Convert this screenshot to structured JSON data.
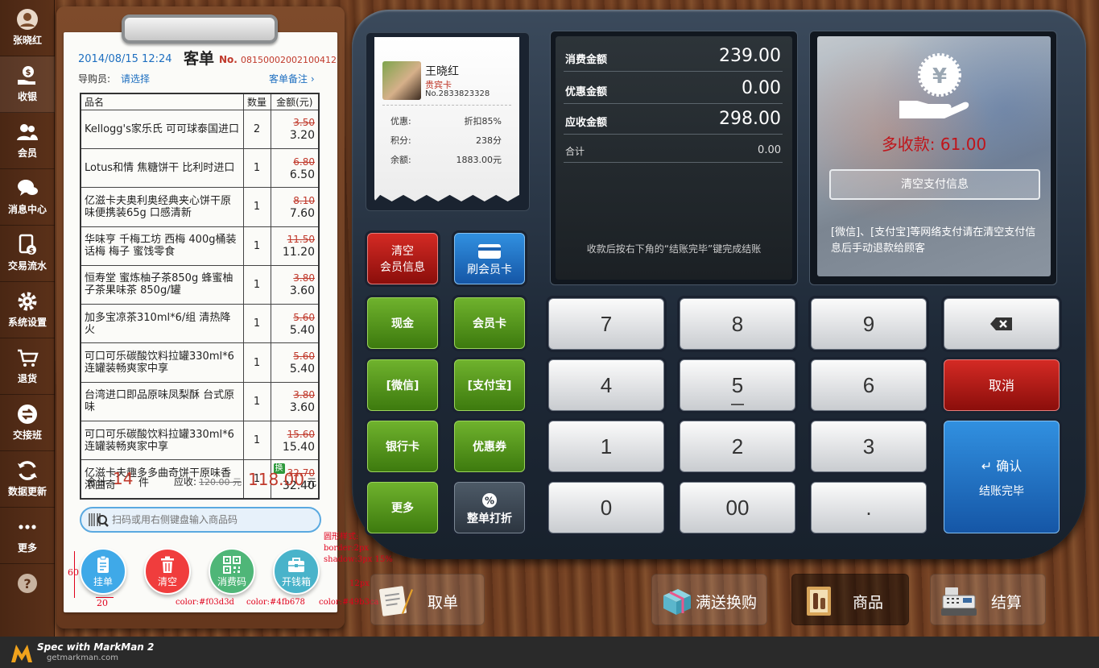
{
  "nav": {
    "items": [
      {
        "label": "张晓红",
        "icon": "user-icon"
      },
      {
        "label": "收银",
        "icon": "cash-hand-icon"
      },
      {
        "label": "会员",
        "icon": "members-icon"
      },
      {
        "label": "消息中心",
        "icon": "message-icon"
      },
      {
        "label": "交易流水",
        "icon": "transactions-icon"
      },
      {
        "label": "系统设置",
        "icon": "gear-icon"
      },
      {
        "label": "退货",
        "icon": "return-cart-icon"
      },
      {
        "label": "交接班",
        "icon": "shift-icon"
      },
      {
        "label": "数据更新",
        "icon": "refresh-icon"
      },
      {
        "label": "更多",
        "icon": "more-icon"
      },
      {
        "label": "",
        "icon": "help-icon"
      }
    ]
  },
  "order": {
    "datetime": "2014/08/15 12:24",
    "title": "客单",
    "no_label": "No.",
    "no": "08150002002100412",
    "guide_label": "导购员:",
    "guide_value": "请选择",
    "note_link": "客单备注",
    "headers": [
      "品名",
      "数量",
      "金额(元)"
    ],
    "rows": [
      {
        "name": "Kellogg's家乐氏 可可球泰国进口",
        "qty": "2",
        "old": "3.50",
        "new": "3.20",
        "badge": ""
      },
      {
        "name": "Lotus和情 焦糖饼干 比利时进口",
        "qty": "1",
        "old": "6.80",
        "new": "6.50",
        "badge": ""
      },
      {
        "name": "亿滋卡夫奥利奥经典夹心饼干原味便携装65g 口感清新",
        "qty": "1",
        "old": "8.10",
        "new": "7.60",
        "badge": ""
      },
      {
        "name": "华味亨 千梅工坊 西梅 400g桶装 话梅 梅子 蜜饯零食",
        "qty": "1",
        "old": "11.50",
        "new": "11.20",
        "badge": ""
      },
      {
        "name": "恒寿堂 蜜炼柚子茶850g 蜂蜜柚子茶果味茶 850g/罐",
        "qty": "1",
        "old": "3.80",
        "new": "3.60",
        "badge": ""
      },
      {
        "name": "加多宝凉茶310ml*6/组 清热降火",
        "qty": "1",
        "old": "5.60",
        "new": "5.40",
        "badge": ""
      },
      {
        "name": "可口可乐碳酸饮料拉罐330ml*6连罐装畅爽家中享",
        "qty": "1",
        "old": "5.60",
        "new": "5.40",
        "badge": ""
      },
      {
        "name": "台湾进口即品原味凤梨酥 台式原味",
        "qty": "1",
        "old": "3.80",
        "new": "3.60",
        "badge": ""
      },
      {
        "name": "可口可乐碳酸饮料拉罐330ml*6连罐装畅爽家中享",
        "qty": "1",
        "old": "15.60",
        "new": "15.40",
        "badge": ""
      },
      {
        "name": "亿滋卡夫趣多多曲奇饼干原味香浓曲奇",
        "qty": "1",
        "old": "32.70",
        "new": "32.40",
        "badge": "换"
      }
    ],
    "total_label": "合计",
    "total_count": "14",
    "total_unit": "件",
    "due_label": "应收:",
    "due_old": "120.00 元",
    "due_new": "118.00",
    "due_unit": "元"
  },
  "search": {
    "placeholder": "扫码或用右侧键盘输入商品码"
  },
  "actions": [
    {
      "label": "挂单",
      "icon": "clipboard-icon",
      "color": "#3fa9e8"
    },
    {
      "label": "清空",
      "icon": "trash-icon",
      "color": "#f03d3d"
    },
    {
      "label": "消费码",
      "icon": "qrcode-icon",
      "color": "#4fb678"
    },
    {
      "label": "开钱箱",
      "icon": "cashbox-icon",
      "color": "#49b3ca"
    }
  ],
  "annotations": {
    "style_title": "圆形样式:",
    "style_border": "border:2px",
    "style_shadow": "shadow:3px 15%",
    "dim_height": "60",
    "dim_gap": "20",
    "dim_12": "12px",
    "color1": "color:#f03d3d",
    "color2": "color:#4fb678",
    "color3": "color:#49b3ca"
  },
  "member": {
    "name": "王晓红",
    "level": "贵宾卡",
    "card_no": "No.2833823328",
    "rows": [
      {
        "label": "优惠:",
        "value": "折扣85%"
      },
      {
        "label": "积分:",
        "value": "238分"
      },
      {
        "label": "余额:",
        "value": "1883.00元"
      }
    ]
  },
  "summary": {
    "rows": [
      {
        "label": "消费金额",
        "value": "239.00"
      },
      {
        "label": "优惠金额",
        "value": "0.00"
      },
      {
        "label": "应收金额",
        "value": "298.00"
      },
      {
        "label": "合计",
        "value": "0.00"
      }
    ],
    "hint": "收款后按右下角的“结账完毕”键完成结账"
  },
  "payment_panel": {
    "overpay_label": "多收款:",
    "overpay_value": "61.00",
    "clear_button": "清空支付信息",
    "note": "[微信]、[支付宝]等网络支付请在清空支付信息后手动退款给顾客"
  },
  "pay_buttons": {
    "clear_member_1": "清空",
    "clear_member_2": "会员信息",
    "swipe_card": "刷会员卡",
    "cash": "现金",
    "member_card": "会员卡",
    "wechat": "[微信]",
    "alipay": "[支付宝]",
    "bank": "银行卡",
    "coupon": "优惠券",
    "more": "更多",
    "discount": "整单打折"
  },
  "keypad": {
    "keys": [
      "7",
      "8",
      "9",
      "4",
      "5",
      "6",
      "1",
      "2",
      "3",
      "0",
      "00",
      "."
    ],
    "cancel": "取消",
    "confirm": "确认",
    "checkout": "结账完毕"
  },
  "bottom": {
    "take_order": "取单",
    "promo": "满送换购",
    "goods": "商品",
    "settle": "结算"
  },
  "footer": {
    "brand_line1": "Spec with MarkMan 2",
    "brand_line2": "getmarkman.com"
  }
}
